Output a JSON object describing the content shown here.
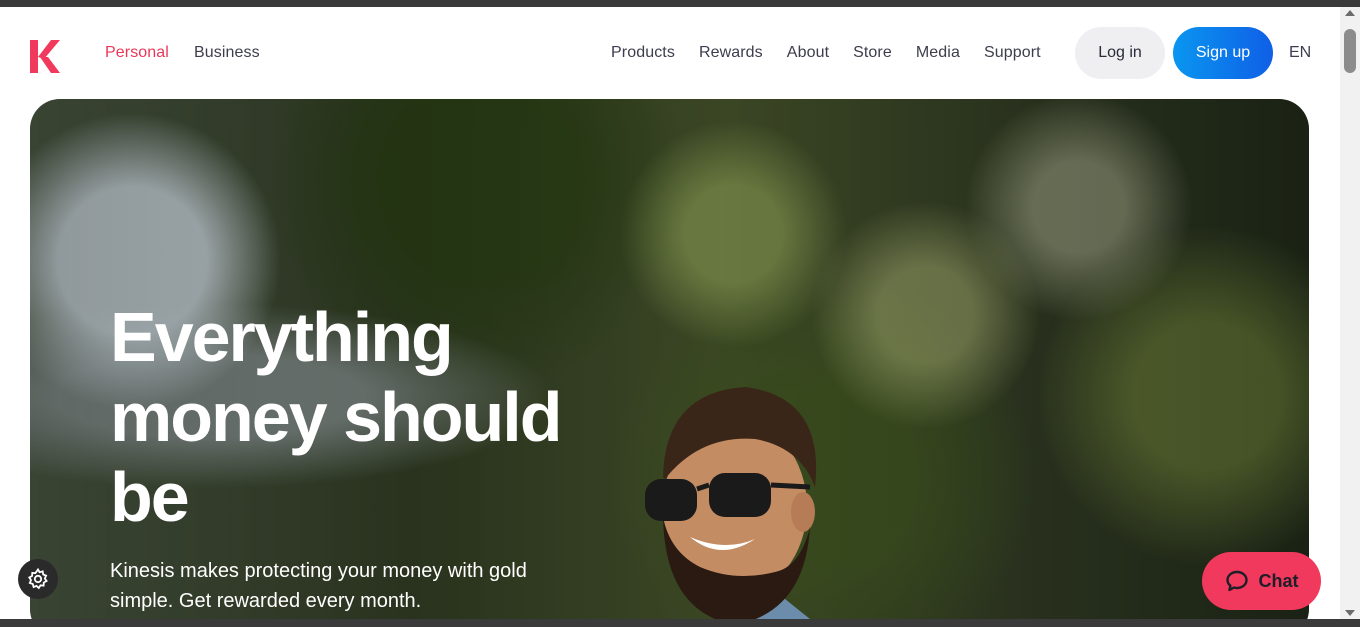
{
  "header": {
    "logo_icon": "kinesis-k-logo",
    "nav_left": [
      {
        "label": "Personal",
        "active": true
      },
      {
        "label": "Business",
        "active": false
      }
    ],
    "nav_right": [
      {
        "label": "Products"
      },
      {
        "label": "Rewards"
      },
      {
        "label": "About"
      },
      {
        "label": "Store"
      },
      {
        "label": "Media"
      },
      {
        "label": "Support"
      }
    ],
    "login_label": "Log in",
    "signup_label": "Sign up",
    "language": "EN"
  },
  "hero": {
    "title": "Everything money should be",
    "subtitle": "Kinesis makes protecting your money with gold simple. Get rewarded every month."
  },
  "floating": {
    "settings_icon": "gear-icon",
    "chat_label": "Chat",
    "chat_icon": "chat-bubble-icon"
  },
  "colors": {
    "accent": "#e8385a",
    "signup_start": "#0a96f0",
    "signup_end": "#0f5fe6",
    "chat_bg": "#f0395c"
  }
}
